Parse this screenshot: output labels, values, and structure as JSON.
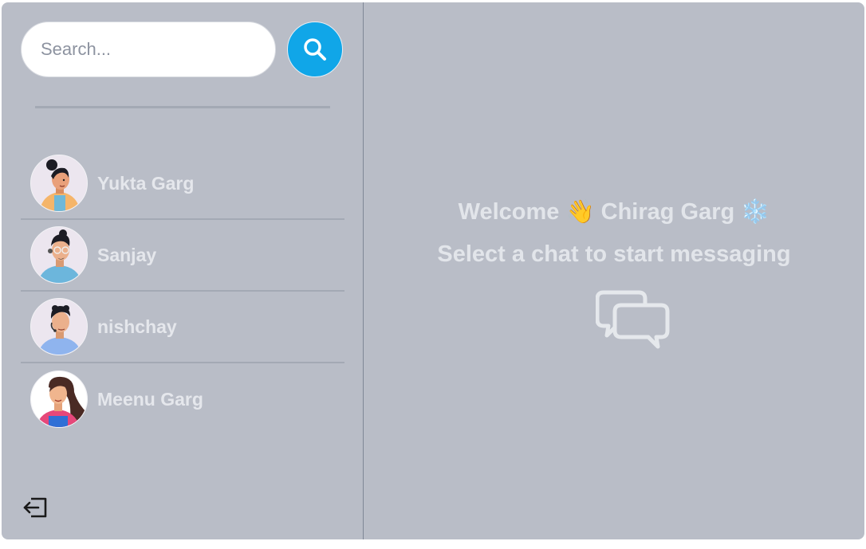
{
  "sidebar": {
    "search": {
      "placeholder": "Search..."
    },
    "chats": [
      {
        "name": "Yukta Garg",
        "avatar": "woman-bun-avatar"
      },
      {
        "name": "Sanjay",
        "avatar": "man-glasses-avatar"
      },
      {
        "name": "nishchay",
        "avatar": "man-headset-avatar"
      },
      {
        "name": "Meenu Garg",
        "avatar": "woman-longhair-avatar"
      }
    ],
    "logout_icon": "logout-icon"
  },
  "main": {
    "welcome_prefix": "Welcome",
    "wave_emoji": "👋",
    "user_name": "Chirag Garg",
    "snow_emoji": "❄️",
    "subtitle": "Select a chat to start messaging",
    "chat_icon": "chat-bubbles-icon"
  },
  "colors": {
    "background": "#b9bdc7",
    "accent": "#10a6e8",
    "text_light": "#e2e5ea"
  }
}
